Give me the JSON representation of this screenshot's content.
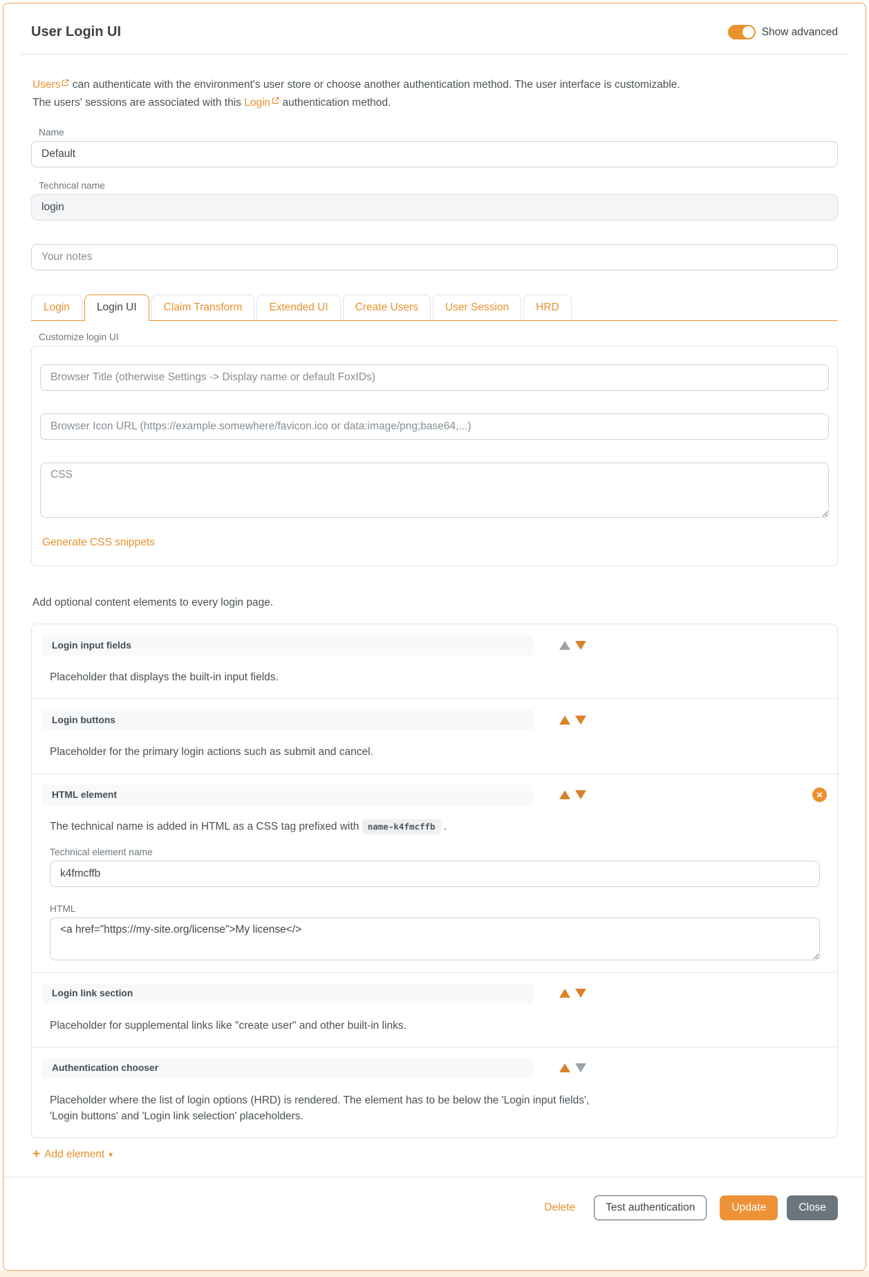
{
  "colors": {
    "accent_orange": "#e8912d",
    "card_border": "#e9a35a",
    "update_button_bg": "#ed9237",
    "close_button_bg": "#6c757d",
    "disabled_arrow_gray": "#9aa1a8",
    "disabled_input_bg": "#f4f6f8"
  },
  "icons": {
    "close_x": "✕",
    "caret_down": "▾",
    "plus": "+"
  },
  "header": {
    "title": "User Login UI",
    "show_advanced_label": "Show advanced",
    "show_advanced_on": true
  },
  "intro": {
    "users_link": "Users",
    "line1_rest": " can authenticate with the environment's user store or choose another authentication method. The user interface is customizable.",
    "line2_start": "The users' sessions are associated with this ",
    "login_link": "Login",
    "line2_rest": " authentication method."
  },
  "fields": {
    "name": {
      "label": "Name",
      "value": "Default"
    },
    "technical_name": {
      "label": "Technical name",
      "value": "login",
      "disabled": true
    },
    "notes": {
      "placeholder": "Your notes"
    }
  },
  "tabs": [
    {
      "label": "Login",
      "active": false
    },
    {
      "label": "Login UI",
      "active": true
    },
    {
      "label": "Claim Transform",
      "active": false
    },
    {
      "label": "Extended UI",
      "active": false
    },
    {
      "label": "Create Users",
      "active": false
    },
    {
      "label": "User Session",
      "active": false
    },
    {
      "label": "HRD",
      "active": false
    }
  ],
  "customize": {
    "label": "Customize login UI",
    "browser_title_placeholder": "Browser Title (otherwise Settings -> Display name or default FoxIDs)",
    "browser_icon_placeholder": "Browser Icon URL (https://example.somewhere/favicon.ico or data:image/png;base64,...)",
    "css_placeholder": "CSS",
    "generate_css_link": "Generate CSS snippets"
  },
  "elements_intro": "Add optional content elements to every login page.",
  "elements": [
    {
      "name": "Login input fields",
      "description": "Placeholder that displays the built-in input fields.",
      "up_enabled": false,
      "down_enabled": true
    },
    {
      "name": "Login buttons",
      "description": "Placeholder for the primary login actions such as submit and cancel.",
      "up_enabled": true,
      "down_enabled": true
    },
    {
      "name": "HTML element",
      "up_enabled": true,
      "down_enabled": true,
      "removable": true,
      "tech_note_before": "The technical name is added in HTML as a CSS tag prefixed with ",
      "tech_chip": "name-k4fmcffb",
      "tech_note_after": " .",
      "tech_name_label": "Technical element name",
      "tech_name_value": "k4fmcffb",
      "html_label": "HTML",
      "html_value": "<a href=\"https://my-site.org/license\">My license</>"
    },
    {
      "name": "Login link section",
      "description": "Placeholder for supplemental links like \"create user\" and other built-in links.",
      "up_enabled": true,
      "down_enabled": true
    },
    {
      "name": "Authentication chooser",
      "description": "Placeholder where the list of login options (HRD) is rendered. The element has to be below the 'Login input fields', 'Login buttons' and 'Login link selection' placeholders.",
      "up_enabled": true,
      "down_enabled": false
    }
  ],
  "add_element_label": "Add element",
  "footer": {
    "delete_label": "Delete",
    "test_label": "Test authentication",
    "update_label": "Update",
    "close_label": "Close"
  }
}
